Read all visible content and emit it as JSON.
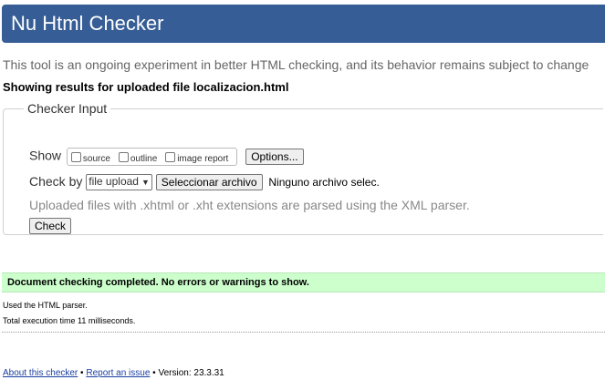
{
  "header": {
    "title": "Nu Html Checker"
  },
  "intro": "This tool is an ongoing experiment in better HTML checking, and its behavior remains subject to change",
  "showing": "Showing results for uploaded file localizacion.html",
  "form": {
    "legend": "Checker Input",
    "show_label": "Show",
    "options": [
      {
        "label": "source",
        "checked": false
      },
      {
        "label": "outline",
        "checked": false
      },
      {
        "label": "image report",
        "checked": false
      }
    ],
    "options_button": "Options...",
    "check_by_label": "Check by",
    "check_by_value": "file upload",
    "choose_file_button": "Seleccionar archivo",
    "no_file_text": "Ninguno archivo selec.",
    "note": "Uploaded files with .xhtml or .xht extensions are parsed using the XML parser.",
    "check_button": "Check"
  },
  "result": {
    "message": "Document checking completed. No errors or warnings to show.",
    "color": "#ccffcc"
  },
  "stats": {
    "parser": "Used the HTML parser.",
    "time": "Total execution time 11 milliseconds."
  },
  "footer": {
    "about_link": "About this checker",
    "sep1": "•",
    "report_link": "Report an issue",
    "sep2": "•",
    "version": "Version: 23.3.31"
  },
  "colors": {
    "header_bg": "#365d95",
    "link": "#1a3f9e"
  }
}
